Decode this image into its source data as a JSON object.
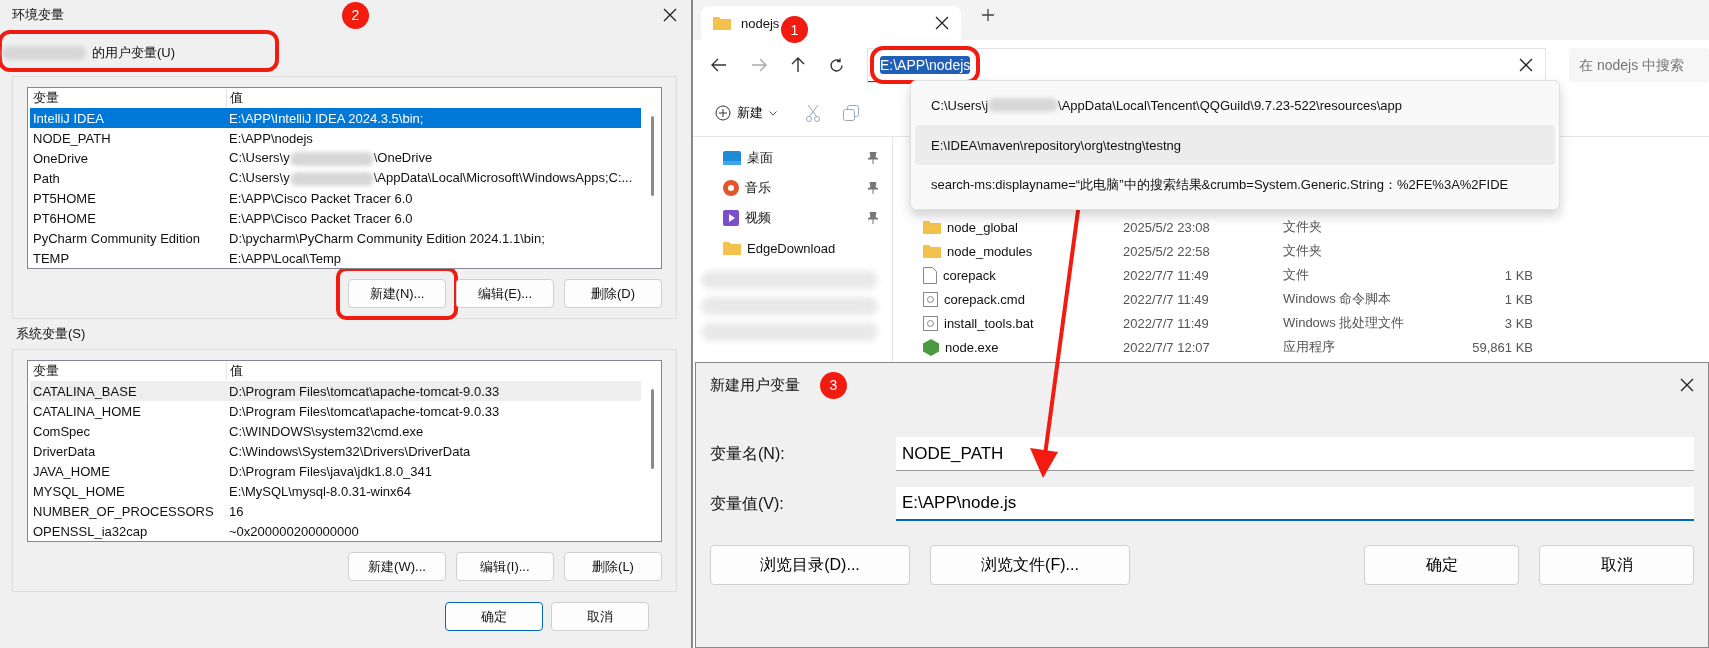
{
  "env_dialog": {
    "title": "环境变量",
    "badge": "2",
    "user_vars": {
      "label": "的用户变量(U)",
      "label_blurred": true,
      "highlighted": true,
      "columns": [
        "变量",
        "值"
      ],
      "rows": [
        {
          "name": "IntelliJ IDEA",
          "value": "E:\\APP\\IntelliJ IDEA 2024.3.5\\bin;",
          "selected": true
        },
        {
          "name": "NODE_PATH",
          "value": "E:\\APP\\nodejs",
          "selected": false
        },
        {
          "name": "OneDrive",
          "value": "C:\\Users\\y",
          "value_after": "\\OneDrive",
          "selected": false
        },
        {
          "name": "Path",
          "value": "C:\\Users\\y",
          "value_after": "\\AppData\\Local\\Microsoft\\WindowsApps;C:...",
          "selected": false
        },
        {
          "name": "PT5HOME",
          "value": "E:\\APP\\Cisco Packet Tracer 6.0",
          "selected": false
        },
        {
          "name": "PT6HOME",
          "value": "E:\\APP\\Cisco Packet Tracer 6.0",
          "selected": false
        },
        {
          "name": "PyCharm Community Edition",
          "value": "D:\\pycharm\\PyCharm Community Edition 2024.1.1\\bin;",
          "selected": false
        },
        {
          "name": "TEMP",
          "value": "E:\\APP\\Local\\Temp",
          "selected": false
        }
      ],
      "buttons": [
        {
          "label": "新建(N)...",
          "highlighted": true
        },
        {
          "label": "编辑(E)...",
          "highlighted": false
        },
        {
          "label": "删除(D)",
          "highlighted": false
        }
      ]
    },
    "system_vars": {
      "label": "系统变量(S)",
      "label_blurred": false,
      "highlighted": false,
      "columns": [
        "变量",
        "值"
      ],
      "rows": [
        {
          "name": "CATALINA_BASE",
          "value": "D:\\Program Files\\tomcat\\apache-tomcat-9.0.33",
          "selected": false,
          "hovered": true
        },
        {
          "name": "CATALINA_HOME",
          "value": "D:\\Program Files\\tomcat\\apache-tomcat-9.0.33",
          "selected": false,
          "hovered": false
        },
        {
          "name": "ComSpec",
          "value": "C:\\WINDOWS\\system32\\cmd.exe",
          "selected": false,
          "hovered": false
        },
        {
          "name": "DriverData",
          "value": "C:\\Windows\\System32\\Drivers\\DriverData",
          "selected": false,
          "hovered": false
        },
        {
          "name": "JAVA_HOME",
          "value": "D:\\Program Files\\java\\jdk1.8.0_341",
          "selected": false,
          "hovered": false
        },
        {
          "name": "MYSQL_HOME",
          "value": "E:\\MySQL\\mysql-8.0.31-winx64",
          "selected": false,
          "hovered": false
        },
        {
          "name": "NUMBER_OF_PROCESSORS",
          "value": "16",
          "selected": false,
          "hovered": false
        },
        {
          "name": "OPENSSL_ia32cap",
          "value": "~0x200000200000000",
          "selected": false,
          "hovered": false
        }
      ],
      "buttons": [
        {
          "label": "新建(W)...",
          "highlighted": false
        },
        {
          "label": "编辑(I)...",
          "highlighted": false
        },
        {
          "label": "删除(L)",
          "highlighted": false
        }
      ]
    },
    "footer_buttons": [
      {
        "label": "确定",
        "default": true
      },
      {
        "label": "取消",
        "default": false
      }
    ]
  },
  "explorer": {
    "tab": {
      "title": "nodejs",
      "badge": "1"
    },
    "address": {
      "value": "E:\\APP\\nodejs",
      "highlighted": true
    },
    "search": {
      "placeholder": "在 nodejs 中搜索"
    },
    "suggestions": [
      {
        "text": "C:\\Users\\j",
        "text_after": "\\AppData\\Local\\Tencent\\QQGuild\\9.7.23-522\\resources\\app",
        "hovered": false
      },
      {
        "text": "E:\\IDEA\\maven\\repository\\org\\testng\\testng",
        "hovered": true
      },
      {
        "text": "search-ms:displayname=“此电脑”中的搜索结果&crumb=System.Generic.String：%2FE%3A%2FIDE",
        "hovered": false
      }
    ],
    "toolbar": {
      "new_label": "新建",
      "has_menu": true
    },
    "sidebar": [
      {
        "kind": "desktop",
        "label": "桌面",
        "pinned": true
      },
      {
        "kind": "music",
        "label": "音乐",
        "pinned": true
      },
      {
        "kind": "video",
        "label": "视频",
        "pinned": true
      },
      {
        "kind": "folder",
        "label": "EdgeDownload",
        "pinned": false
      },
      {
        "kind": "blurred"
      },
      {
        "kind": "blurred"
      },
      {
        "kind": "blurred"
      }
    ],
    "files": [
      {
        "kind": "folder",
        "name": "node_global",
        "modified": "2025/5/2 23:08",
        "type": "文件夹"
      },
      {
        "kind": "folder",
        "name": "node_modules",
        "modified": "2025/5/2 22:58",
        "type": "文件夹"
      },
      {
        "kind": "file",
        "name": "corepack",
        "modified": "2022/7/7 11:49",
        "type": "文件",
        "size": "1 KB"
      },
      {
        "kind": "script",
        "name": "corepack.cmd",
        "modified": "2022/7/7 11:49",
        "type": "Windows 命令脚本",
        "size": "1 KB"
      },
      {
        "kind": "script",
        "name": "install_tools.bat",
        "modified": "2022/7/7 11:49",
        "type": "Windows 批处理文件",
        "size": "3 KB"
      },
      {
        "kind": "exe",
        "name": "node.exe",
        "modified": "2022/7/7 12:07",
        "type": "应用程序",
        "size": "59,861 KB"
      }
    ]
  },
  "new_var_dialog": {
    "title": "新建用户变量",
    "badge": "3",
    "fields": [
      {
        "label": "变量名(N):",
        "value": "NODE_PATH",
        "focused": false
      },
      {
        "label": "变量值(V):",
        "value": "E:\\APP\\node.js",
        "focused": true
      }
    ],
    "left_buttons": [
      "浏览目录(D)...",
      "浏览文件(F)..."
    ],
    "right_buttons": [
      "确定",
      "取消"
    ]
  }
}
